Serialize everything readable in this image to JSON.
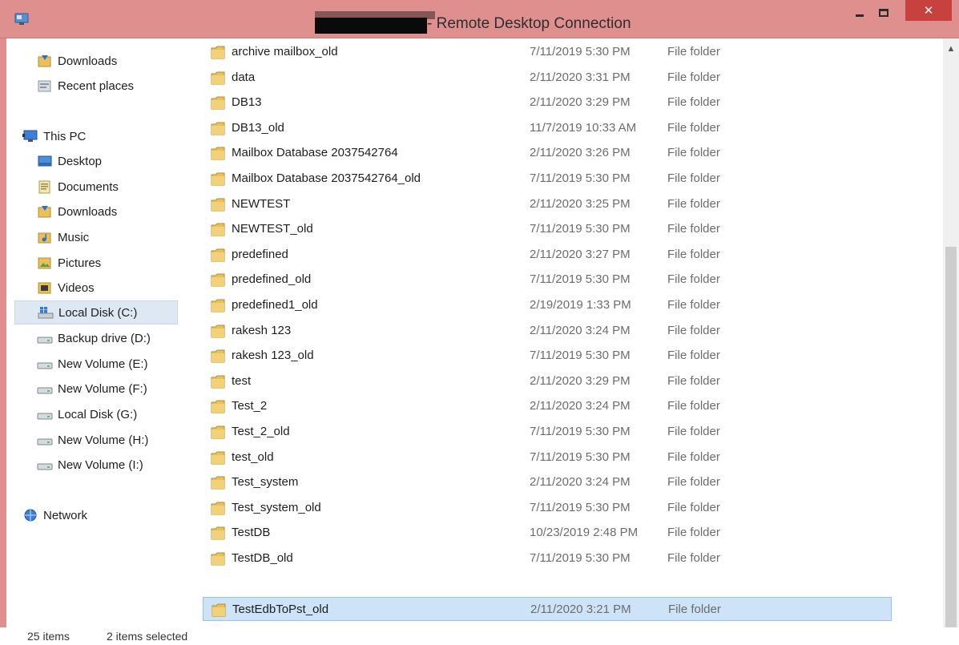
{
  "window": {
    "title": "- Remote Desktop Connection",
    "minimize_glyph": "—",
    "close_glyph": "✕"
  },
  "nav": {
    "items": [
      {
        "label": "Downloads",
        "icon": "downloads-icon"
      },
      {
        "label": "Recent places",
        "icon": "recent-places-icon"
      },
      {
        "label": "This PC",
        "icon": "this-pc-icon"
      },
      {
        "label": "Desktop",
        "icon": "desktop-icon"
      },
      {
        "label": "Documents",
        "icon": "documents-icon"
      },
      {
        "label": "Downloads",
        "icon": "downloads-icon"
      },
      {
        "label": "Music",
        "icon": "music-icon"
      },
      {
        "label": "Pictures",
        "icon": "pictures-icon"
      },
      {
        "label": "Videos",
        "icon": "videos-icon"
      },
      {
        "label": "Local Disk (C:)",
        "icon": "windows-drive-icon"
      },
      {
        "label": "Backup drive (D:)",
        "icon": "drive-icon"
      },
      {
        "label": "New Volume (E:)",
        "icon": "drive-icon"
      },
      {
        "label": "New Volume (F:)",
        "icon": "drive-icon"
      },
      {
        "label": "Local Disk (G:)",
        "icon": "drive-icon"
      },
      {
        "label": "New Volume (H:)",
        "icon": "drive-icon"
      },
      {
        "label": "New Volume (I:)",
        "icon": "drive-icon"
      },
      {
        "label": "Network",
        "icon": "network-icon"
      }
    ]
  },
  "files": [
    {
      "name": "archive mailbox_old",
      "date": "7/11/2019 5:30 PM",
      "type": "File folder"
    },
    {
      "name": "data",
      "date": "2/11/2020 3:31 PM",
      "type": "File folder"
    },
    {
      "name": "DB13",
      "date": "2/11/2020 3:29 PM",
      "type": "File folder"
    },
    {
      "name": "DB13_old",
      "date": "11/7/2019 10:33 AM",
      "type": "File folder"
    },
    {
      "name": "Mailbox Database 2037542764",
      "date": "2/11/2020 3:26 PM",
      "type": "File folder"
    },
    {
      "name": "Mailbox Database 2037542764_old",
      "date": "7/11/2019 5:30 PM",
      "type": "File folder"
    },
    {
      "name": "NEWTEST",
      "date": "2/11/2020 3:25 PM",
      "type": "File folder"
    },
    {
      "name": "NEWTEST_old",
      "date": "7/11/2019 5:30 PM",
      "type": "File folder"
    },
    {
      "name": "predefined",
      "date": "2/11/2020 3:27 PM",
      "type": "File folder"
    },
    {
      "name": "predefined_old",
      "date": "7/11/2019 5:30 PM",
      "type": "File folder"
    },
    {
      "name": "predefined1_old",
      "date": "2/19/2019 1:33 PM",
      "type": "File folder"
    },
    {
      "name": "rakesh 123",
      "date": "2/11/2020 3:24 PM",
      "type": "File folder"
    },
    {
      "name": "rakesh 123_old",
      "date": "7/11/2019 5:30 PM",
      "type": "File folder"
    },
    {
      "name": "test",
      "date": "2/11/2020 3:29 PM",
      "type": "File folder"
    },
    {
      "name": "Test_2",
      "date": "2/11/2020 3:24 PM",
      "type": "File folder"
    },
    {
      "name": "Test_2_old",
      "date": "7/11/2019 5:30 PM",
      "type": "File folder"
    },
    {
      "name": "test_old",
      "date": "7/11/2019 5:30 PM",
      "type": "File folder"
    },
    {
      "name": "Test_system",
      "date": "2/11/2020 3:24 PM",
      "type": "File folder"
    },
    {
      "name": "Test_system_old",
      "date": "7/11/2019 5:30 PM",
      "type": "File folder"
    },
    {
      "name": "TestDB",
      "date": "10/23/2019 2:48 PM",
      "type": "File folder"
    },
    {
      "name": "TestDB_old",
      "date": "7/11/2019 5:30 PM",
      "type": "File folder"
    },
    {
      "name": "TestEdbToPst_old",
      "date": "2/11/2020 3:21 PM",
      "type": "File folder",
      "selected": true
    }
  ],
  "status": {
    "item_count": "25 items",
    "selection": "2 items selected"
  },
  "colors": {
    "titlebar": "#e08f8f",
    "close_button": "#c7423e",
    "selection": "#cde3f7",
    "folder": "#e8c15a"
  }
}
